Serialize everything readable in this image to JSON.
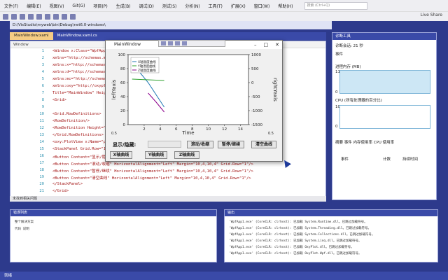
{
  "menubar": {
    "items": [
      "文件(F)",
      "编辑(E)",
      "视图(V)",
      "Git(G)",
      "项目(P)",
      "生成(B)",
      "调试(D)",
      "测试(S)",
      "分析(N)",
      "工具(T)",
      "扩展(X)",
      "窗口(W)",
      "帮助(H)"
    ],
    "search_placeholder": "搜索 (Ctrl+Q)"
  },
  "toolbar": {
    "live_share": "Live Share"
  },
  "path": "D:\\VisStudio\\myweb\\bin\\Debug\\net6.0-windows\\",
  "editor": {
    "tabs": [
      "MainWindow.xaml",
      "MainWindow.xaml.cs"
    ],
    "crumb": "Window",
    "status": "未找到相关问题",
    "line_numbers": [
      "1",
      "2",
      "3",
      "4",
      "5",
      "6",
      "7",
      "8",
      "9",
      "10",
      "11",
      "12",
      "13",
      "14",
      "15",
      "16",
      "17",
      "18",
      "19",
      "20",
      "21"
    ],
    "code_lines": [
      "<Window x:Class=\"WpfApp1.MainWindow\"",
      "        xmlns=\"http://schemas.microsoft.com/winfx/2006/xaml/presentation\"",
      "        xmlns:x=\"http://schemas.microsoft.com/winfx/2006/xaml\"",
      "        xmlns:d=\"http://schemas.microsoft.com/expression/blend/2008\"",
      "        xmlns:mc=\"http://schemas.openxmlformats.org/markup-compatibility/2006\"",
      "        xmlns:oxy=\"http://oxyplot.org/wpf\"",
      "        Title=\"MainWindow\" Height=\"450\" Width=\"800\">",
      "    <Grid>",
      "",
      "        <Grid.RowDefinitions>",
      "            <RowDefinition/>",
      "            <RowDefinition Height=\"Auto\"/>",
      "        </Grid.RowDefinitions>",
      "        <oxy:PlotView x:Name=\"plotView\" Model=\"{Binding PlotModel}\"/>",
      "        <StackPanel Grid.Row=\"1\" Orientation=\"Horizontal\">",
      "            <Button Content=\"显示/隐藏\" HorizontalAlignment=\"Left\" Margin=\"10,4,10,4\" Grid.Row=\"1\"/>",
      "            <Button Content=\"滚动/收缩\" HorizontalAlignment=\"Left\" Margin=\"10,4,10,4\" Grid.Row=\"1\"/>",
      "            <Button Content=\"暂停/继续\" HorizontalAlignment=\"Left\" Margin=\"10,4,10,4\" Grid.Row=\"1\"/>",
      "            <Button Content=\"清空曲线\" HorizontalAlignment=\"Left\" Margin=\"10,4,10,4\" Grid.Row=\"1\"/>",
      "        </StackPanel>",
      "    </Grid>"
    ]
  },
  "diagnostics": {
    "title": "诊断工具",
    "session": "诊断会话: 21 秒",
    "events": "事件",
    "memory": "进程内存 (MB)",
    "cpu": "CPU (所有处理器的百分比)",
    "mem_top": "11",
    "mem_bottom": "0",
    "cpu_top": "100",
    "cpu_bottom": "0",
    "tabs": "摘要  事件  内存使用率  CPU 使用率",
    "col1": "事件",
    "col2": "计数",
    "col3": "持续时间"
  },
  "app_window": {
    "title": "MainWindow",
    "legend": [
      "X轴温度曲线",
      "Y轴温度曲线",
      "Z轴温度曲线"
    ],
    "left_axis_title": "leftYaxis",
    "right_axis_title": "rightYaxis",
    "x_axis_title": "Time",
    "left_ticks": [
      "100",
      "80",
      "60",
      "40",
      "20",
      "0"
    ],
    "right_ticks": [
      "1000",
      "500",
      "0",
      "-500",
      "-1000",
      "-1500"
    ],
    "x_ticks": [
      "2",
      "4",
      "6",
      "8",
      "10",
      "12",
      "14"
    ],
    "x_range_left": "0.5",
    "x_range_right": "0.5",
    "label_show_hide": "显示/隐藏:",
    "btn_scroll": "滚动/收缩",
    "btn_pause": "暂停/继续",
    "btn_clear": "清空曲线",
    "btn_x": "X轴曲线",
    "btn_y": "Y轴曲线",
    "btn_z": "Z轴曲线"
  },
  "bottom_panels": {
    "left_title": "错误列表",
    "left_lines": [
      "整个解决方案",
      "代码  说明"
    ],
    "right_title": "输出",
    "right_lines": [
      "'WpfApp1.exe' (CoreCLR: clrhost): 已加载 System.Runtime.dll。已跳过加载符号。",
      "'WpfApp1.exe' (CoreCLR: clrhost): 已加载 System.Threading.dll。已跳过加载符号。",
      "'WpfApp1.exe' (CoreCLR: clrhost): 已加载 System.Collections.dll。已跳过加载符号。",
      "'WpfApp1.exe' (CoreCLR: clrhost): 已加载 System.Linq.dll。已跳过加载符号。",
      "'WpfApp1.exe' (CoreCLR: clrhost): 已加载 OxyPlot.dll。已跳过加载符号。",
      "'WpfApp1.exe' (CoreCLR: clrhost): 已加载 OxyPlot.Wpf.dll。已跳过加载符号。"
    ]
  },
  "status_bar": "就绪",
  "chart_data": {
    "type": "line",
    "x_range": [
      0,
      15
    ],
    "y_left_range": [
      0,
      100
    ],
    "y_right_range": [
      -1500,
      1000
    ],
    "legend_position": "top-left",
    "series": [
      {
        "name": "X轴温度曲线",
        "color": "#1f77b4",
        "x": [
          0.5,
          2.5,
          4.5
        ],
        "y": [
          88,
          60,
          25
        ]
      },
      {
        "name": "Y轴温度曲线",
        "color": "#2ca02c",
        "x": [
          0.5,
          2.5,
          4.5
        ],
        "y": [
          65,
          64,
          63
        ]
      },
      {
        "name": "Z轴温度曲线",
        "color": "#8b008b",
        "x": [
          2.5,
          3.5,
          4.5
        ],
        "y": [
          45,
          32,
          18
        ]
      }
    ]
  }
}
